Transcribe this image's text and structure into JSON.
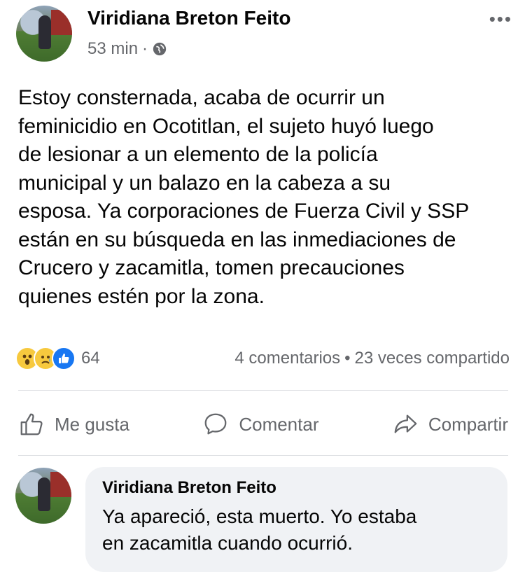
{
  "post": {
    "author": "Viridiana Breton Feito",
    "time": "53 min",
    "separator": "·",
    "privacy_icon": "globe-icon",
    "more_icon": "more-options-icon",
    "text_lines": [
      "Estoy consternada, acaba de ocurrir un",
      "feminicidio en Ocotitlan, el sujeto huyó luego",
      "de lesionar a un elemento de la policía",
      "municipal y un balazo en la cabeza a su",
      "esposa. Ya corporaciones de Fuerza Civil y SSP",
      "están en su búsqueda en las inmediaciones de",
      "Crucero y zacamitla, tomen precauciones",
      "quienes estén por la zona."
    ]
  },
  "stats": {
    "reaction_icons": [
      "wow-icon",
      "sad-icon",
      "like-icon"
    ],
    "reaction_count": "64",
    "comments": "4 comentarios",
    "separator": "•",
    "shares": "23 veces compartido"
  },
  "actions": {
    "like_label": "Me gusta",
    "comment_label": "Comentar",
    "share_label": "Compartir"
  },
  "comment": {
    "author": "Viridiana Breton Feito",
    "text_lines": [
      "Ya apareció, esta muerto. Yo estaba",
      "en zacamitla cuando ocurrió."
    ]
  },
  "colors": {
    "secondary_text": "#65676b",
    "like_blue": "#1877f2",
    "reaction_yellow": "#f7c93e",
    "comment_bg": "#f0f2f5"
  }
}
